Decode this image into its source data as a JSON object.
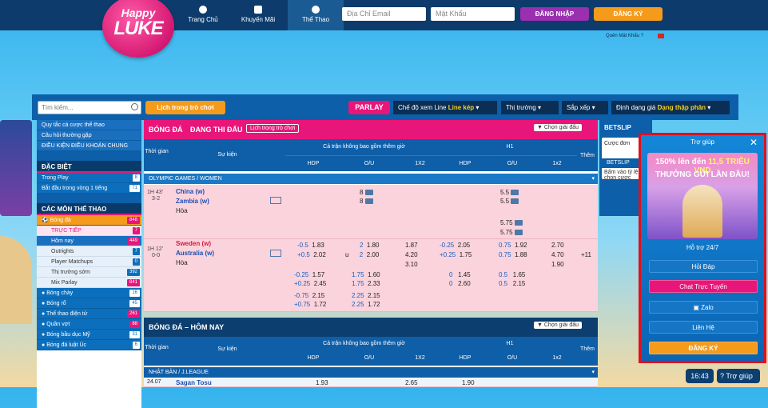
{
  "brand": {
    "line1": "Happy",
    "line2": "LUKE"
  },
  "nav": [
    {
      "label": "Trang Chủ",
      "icon": "soccer-ball-icon"
    },
    {
      "label": "Khuyến Mãi",
      "icon": "gift-icon"
    },
    {
      "label": "Thể Thao",
      "icon": "soccer-ball-icon"
    }
  ],
  "auth": {
    "email_placeholder": "Địa Chỉ Email",
    "password_placeholder": "Mật Khẩu",
    "login": "ĐĂNG NHẬP",
    "register": "ĐĂNG KÝ",
    "forgot": "Quên Mật Khẩu ?"
  },
  "toolbar": {
    "search_placeholder": "Tìm kiếm...",
    "schedule": "Lịch trong trò chơi",
    "parlay": "PARLAY",
    "view_mode": "Chế độ xem Line",
    "view_mode_value": "Line kép",
    "market": "Thị trường",
    "sort": "Sắp xếp",
    "odds_format": "Định dạng giá",
    "odds_format_value": "Dạng thập phân"
  },
  "sidebar": {
    "links": [
      "Quy tắc cá cược thể thao",
      "Câu hỏi thường gặp",
      "ĐIỀU KIỆN ĐIỀU KHOẢN CHUNG"
    ],
    "special_header": "ĐẶC BIỆT",
    "special": [
      {
        "label": "Trong Play",
        "count": "8"
      },
      {
        "label": "Bắt đầu trong vòng 1 tiếng",
        "count": "71"
      }
    ],
    "sports_header": "CÁC MÔN THỂ THAO",
    "football": {
      "label": "Bóng đá",
      "count": "848"
    },
    "football_sub": [
      {
        "label": "TRỰC TIẾP",
        "count": "7"
      },
      {
        "label": "Hôm nay",
        "count": "449"
      },
      {
        "label": "Outrights",
        "count": "7"
      },
      {
        "label": "Player Matchups",
        "count": "0"
      },
      {
        "label": "Thị trường sớm",
        "count": "392"
      },
      {
        "label": "Mix Parlay",
        "count": "841"
      }
    ],
    "sports": [
      {
        "label": "Bóng chày",
        "count": "16"
      },
      {
        "label": "Bóng rổ",
        "count": "45"
      },
      {
        "label": "Thể thao điện tử",
        "count": "261"
      },
      {
        "label": "Quần vợt",
        "count": "88"
      },
      {
        "label": "Bóng bầu dục Mỹ",
        "count": "31"
      },
      {
        "label": "Bóng đá luật Úc",
        "count": "6"
      }
    ]
  },
  "section1": {
    "title": "BÓNG ĐÁ",
    "subtitle": "ĐANG THI ĐẤU",
    "schedule": "Lịch trong trò chơi",
    "choose": "Chọn giải đấu",
    "col_time": "Thời gian",
    "col_event": "Sự kiện",
    "group_full": "Cả trận không bao gồm thêm giờ",
    "group_half": "H1",
    "cols": [
      "HDP",
      "O/U",
      "1X2",
      "HDP",
      "O/U",
      "1x2"
    ],
    "more": "Thêm",
    "league": "OLYMPIC GAMES / WOMEN",
    "match1": {
      "time": "1H 43'",
      "score": "3-2",
      "home": "China (w)",
      "away": "Zambia (w)",
      "draw": "Hòa",
      "ou_a": "8",
      "ou_b": "8",
      "h1_a": "5.5",
      "h1_b": "5.5",
      "h1_c": "5.75",
      "h1_d": "5.75"
    },
    "match2": {
      "time": "1H 12'",
      "score": "0-0",
      "home": "Sweden (w)",
      "away": "Australia (w)",
      "draw": "Hòa",
      "hdp_l": "-0.5",
      "hdp_o1": "1.83",
      "hdp_l2": "+0.5",
      "hdp_o2": "2.02",
      "ou_l": "2",
      "ou_o1": "1.80",
      "ou_l2": "u",
      "ou_o2": "2.00",
      "x1": "1.87",
      "x2": "4.20",
      "x3": "3.10",
      "h1hdp_l": "-0.25",
      "h1hdp_o1": "2.05",
      "h1hdp_l2": "+0.25",
      "h1hdp_o2": "1.75",
      "h1ou_l": "0.75",
      "h1ou_o1": "1.92",
      "h1ou_l2": "0.75",
      "h1ou_o2": "1.88",
      "h1x1": "2.70",
      "h1x2": "4.70",
      "h1x3": "1.90",
      "more": "+11"
    },
    "extra": [
      {
        "hl": "-0.25",
        "ho1": "1.57",
        "hl2": "+0.25",
        "ho2": "2.45",
        "ol": "1.75",
        "oo1": "1.60",
        "ol2": "1.75",
        "oo2": "2.33",
        "hh1": "1.45",
        "hh2": "2.60",
        "hhl": "0",
        "hhl2": "0",
        "ho3": "1.65",
        "ho4": "2.15",
        "hol": "0.5",
        "hol2": "0.5"
      },
      {
        "hl": "-0.75",
        "ho1": "2.15",
        "hl2": "+0.75",
        "ho2": "1.72",
        "ol": "2.25",
        "oo1": "2.15",
        "ol2": "2.25",
        "oo2": "1.72"
      }
    ]
  },
  "section2": {
    "title": "BÓNG ĐÁ – HÔM NAY",
    "choose": "Chọn giải đấu",
    "col_time": "Thời gian",
    "col_event": "Sự kiện",
    "group_full": "Cả trận không bao gồm thêm giờ",
    "group_half": "H1",
    "cols": [
      "HDP",
      "O/U",
      "1X2",
      "HDP",
      "O/U",
      "1x2"
    ],
    "more": "Thêm",
    "league": "NHẬT BẢN / J.LEAGUE",
    "row": {
      "date": "24.07",
      "team": "Sagan Tosu",
      "a": "1.93",
      "b": "2.65",
      "c": "1.90"
    }
  },
  "betslip": {
    "title": "BETSLIP",
    "tab1": "Cược đơn",
    "tab2": "BETSLIP",
    "hint": "Bấm vào tỷ lệ để chọn cược"
  },
  "popup": {
    "title": "Trợ giúp",
    "banner_line1": "150% lên đến",
    "banner_amount": "11,5 TRIỆU VND",
    "banner_line2": "THƯỞNG GỬI LẦN ĐẦU!",
    "support": "Hỗ trợ 24/7",
    "buttons": [
      "Hỏi Đáp",
      "Chat Trực Tuyến",
      "Zalo",
      "Liên Hệ"
    ],
    "register": "ĐĂNG KÝ"
  },
  "footer": {
    "time": "16:43",
    "help": "Trợ giúp"
  },
  "colors": {
    "navy": "#0d3c6c",
    "pink": "#e8167a",
    "orange": "#f59b1b",
    "blue": "#0c6fbd"
  }
}
